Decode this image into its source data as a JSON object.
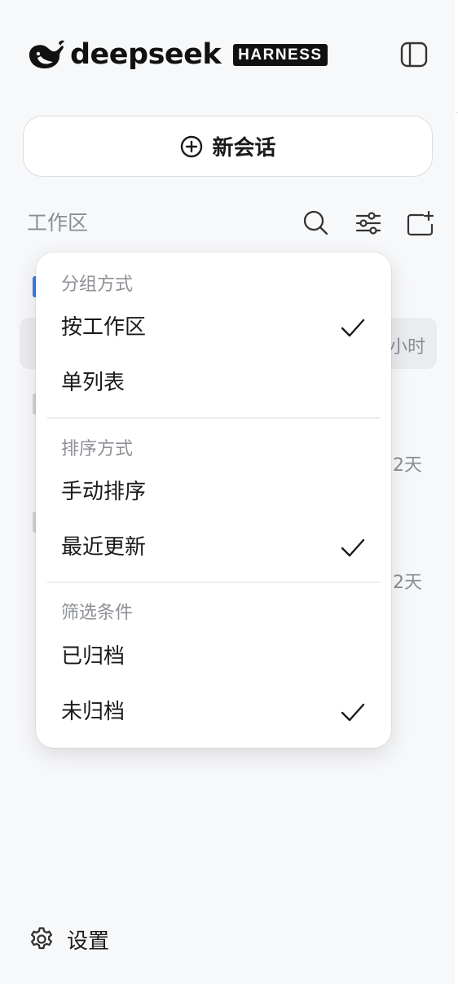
{
  "brand": {
    "wordmark": "deepseek",
    "badge": "HARNESS",
    "logo_icon": "whale-logo-icon"
  },
  "header": {
    "toggle_icon": "sidebar-toggle-icon"
  },
  "new_chat": {
    "icon": "plus-circle-icon",
    "label": "新会话"
  },
  "workspace": {
    "label": "工作区",
    "icons": [
      "search-icon",
      "filter-sliders-icon",
      "new-folder-icon"
    ]
  },
  "background_list": {
    "times": [
      "小时",
      "2天",
      "2天"
    ]
  },
  "menu": {
    "sections": [
      {
        "title": "分组方式",
        "options": [
          {
            "label": "按工作区",
            "checked": true
          },
          {
            "label": "单列表",
            "checked": false
          }
        ]
      },
      {
        "title": "排序方式",
        "options": [
          {
            "label": "手动排序",
            "checked": false
          },
          {
            "label": "最近更新",
            "checked": true
          }
        ]
      },
      {
        "title": "筛选条件",
        "options": [
          {
            "label": "已归档",
            "checked": false
          },
          {
            "label": "未归档",
            "checked": true
          }
        ]
      }
    ],
    "check_icon": "checkmark-icon"
  },
  "footer": {
    "settings_label": "设置",
    "settings_icon": "gear-icon"
  },
  "colors": {
    "sidebar_bg": "#f7f8fa",
    "text": "#1a1a1a",
    "muted": "#8a8d93",
    "accent_stub": "#3b7bf0"
  }
}
